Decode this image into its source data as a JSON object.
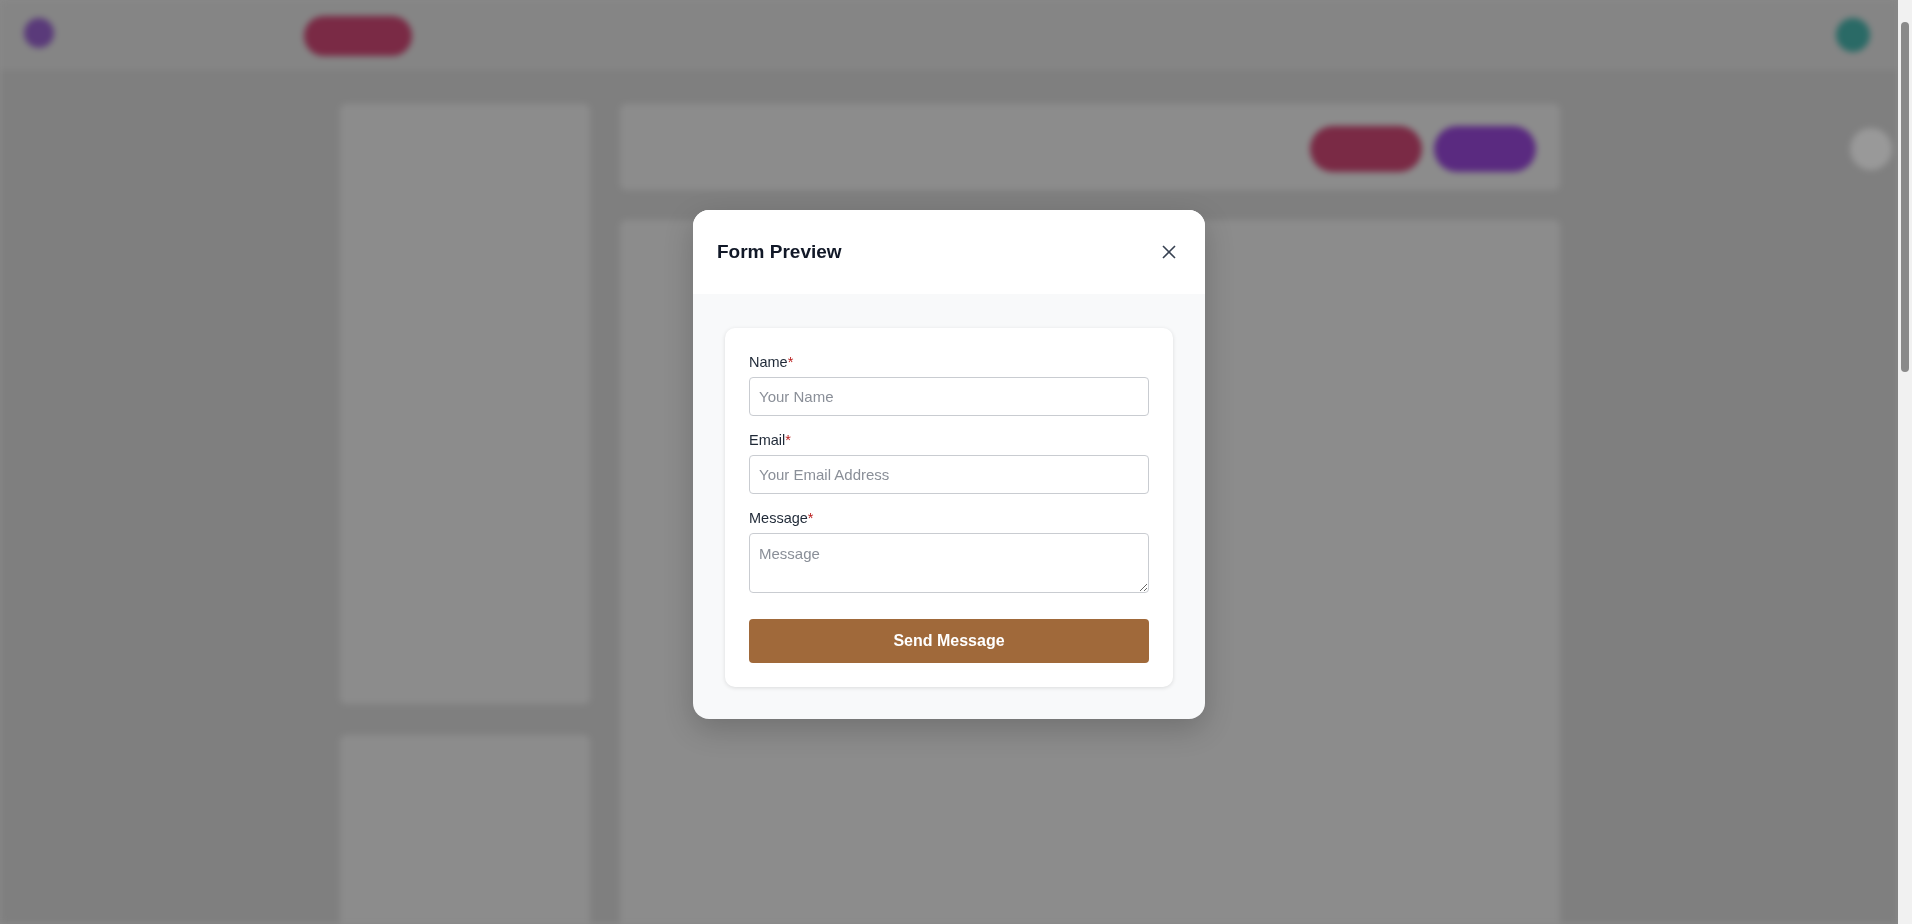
{
  "modal": {
    "title": "Form Preview",
    "fields": [
      {
        "kind": "input",
        "label": "Name",
        "required_mark": "*",
        "placeholder": "Your Name"
      },
      {
        "kind": "input",
        "label": "Email",
        "required_mark": "*",
        "placeholder": "Your Email Address"
      },
      {
        "kind": "textarea",
        "label": "Message",
        "required_mark": "*",
        "placeholder": "Message"
      }
    ],
    "submit_button": "Send Message"
  }
}
